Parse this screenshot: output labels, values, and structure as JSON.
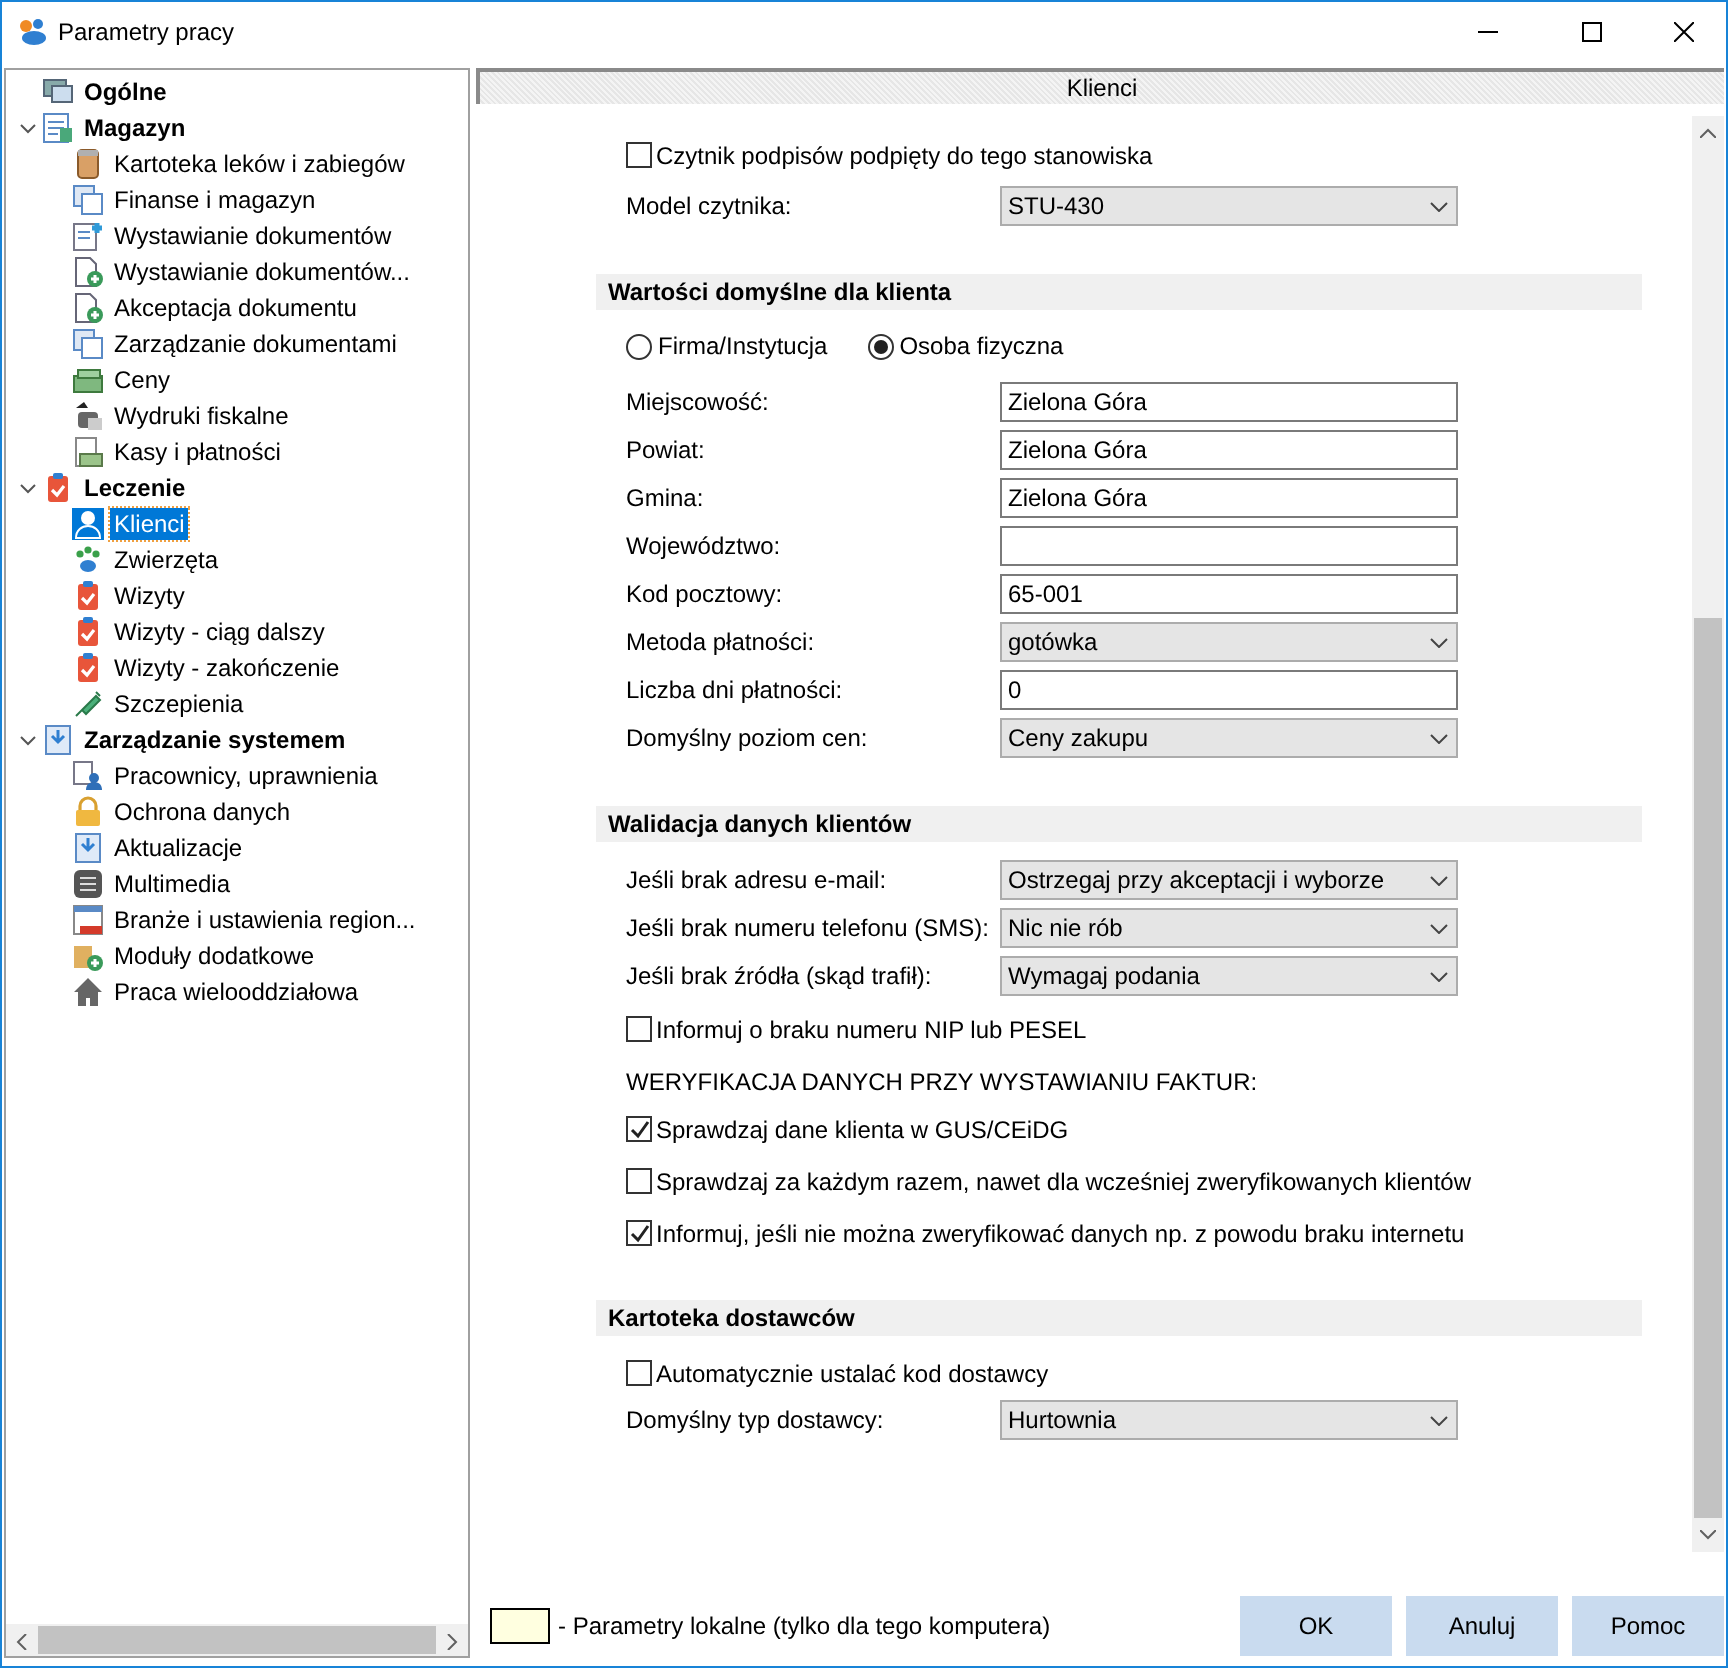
{
  "window": {
    "title": "Parametry pracy"
  },
  "tree": [
    {
      "label": "Ogólne",
      "selected": false
    },
    {
      "label": "Magazyn",
      "selected": false,
      "expanded": true,
      "children": [
        {
          "label": "Kartoteka leków i zabiegów",
          "selected": false
        },
        {
          "label": "Finanse i magazyn",
          "selected": false
        },
        {
          "label": "Wystawianie dokumentów",
          "selected": false
        },
        {
          "label": "Wystawianie dokumentów...",
          "selected": false
        },
        {
          "label": "Akceptacja dokumentu",
          "selected": false
        },
        {
          "label": "Zarządzanie dokumentami",
          "selected": false
        },
        {
          "label": "Ceny",
          "selected": false
        },
        {
          "label": "Wydruki fiskalne",
          "selected": false
        },
        {
          "label": "Kasy i płatności",
          "selected": false
        }
      ]
    },
    {
      "label": "Leczenie",
      "selected": false,
      "expanded": true,
      "children": [
        {
          "label": "Klienci",
          "selected": true
        },
        {
          "label": "Zwierzęta",
          "selected": false
        },
        {
          "label": "Wizyty",
          "selected": false
        },
        {
          "label": "Wizyty - ciąg dalszy",
          "selected": false
        },
        {
          "label": "Wizyty - zakończenie",
          "selected": false
        },
        {
          "label": "Szczepienia",
          "selected": false
        }
      ]
    },
    {
      "label": "Zarządzanie systemem",
      "selected": false,
      "expanded": true,
      "children": [
        {
          "label": "Pracownicy, uprawnienia",
          "selected": false
        },
        {
          "label": "Ochrona danych",
          "selected": false
        },
        {
          "label": "Aktualizacje",
          "selected": false
        },
        {
          "label": "Multimedia",
          "selected": false
        },
        {
          "label": "Branże i ustawienia region...",
          "selected": false
        },
        {
          "label": "Moduły dodatkowe",
          "selected": false
        },
        {
          "label": "Praca wielooddziałowa",
          "selected": false
        }
      ]
    }
  ],
  "panel": {
    "title": "Klienci"
  },
  "content": [
    {
      "kind": "checkbox",
      "label": "Czytnik podpisów podpięty do tego stanowiska",
      "checked": false
    },
    {
      "kind": "select",
      "label": "Model czytnika:",
      "value": "STU-430"
    },
    {
      "kind": "section",
      "label": "Wartości domyślne dla klienta"
    },
    {
      "kind": "radios",
      "options": [
        {
          "label": "Firma/Instytucja",
          "selected": false
        },
        {
          "label": "Osoba fizyczna",
          "selected": true
        }
      ]
    },
    {
      "kind": "input",
      "label": "Miejscowość:",
      "value": "Zielona Góra"
    },
    {
      "kind": "input",
      "label": "Powiat:",
      "value": "Zielona Góra"
    },
    {
      "kind": "input",
      "label": "Gmina:",
      "value": "Zielona Góra"
    },
    {
      "kind": "input",
      "label": "Województwo:"
    },
    {
      "kind": "input",
      "label": "Kod pocztowy:",
      "value": "65-001"
    },
    {
      "kind": "select",
      "label": "Metoda płatności:",
      "value": "gotówka"
    },
    {
      "kind": "input",
      "label": "Liczba dni płatności:",
      "value": "0"
    },
    {
      "kind": "select",
      "label": "Domyślny poziom cen:",
      "value": "Ceny zakupu"
    },
    {
      "kind": "section",
      "label": "Walidacja danych klientów"
    },
    {
      "kind": "select",
      "label": "Jeśli brak adresu e-mail:",
      "value": "Ostrzegaj przy akceptacji i wyborze"
    },
    {
      "kind": "select",
      "label": "Jeśli brak numeru telefonu (SMS):",
      "value": "Nic nie rób"
    },
    {
      "kind": "select",
      "label": "Jeśli brak źródła (skąd trafił):",
      "value": "Wymagaj podania"
    },
    {
      "kind": "checkbox",
      "label": "Informuj o braku numeru NIP lub PESEL",
      "checked": false
    },
    {
      "kind": "note",
      "label": "WERYFIKACJA DANYCH PRZY WYSTAWIANIU FAKTUR:"
    },
    {
      "kind": "checkbox",
      "label": "Sprawdzaj dane klienta w GUS/CEiDG",
      "checked": true
    },
    {
      "kind": "checkbox",
      "label": "Sprawdzaj za każdym razem, nawet dla wcześniej zweryfikowanych klientów",
      "checked": false
    },
    {
      "kind": "checkbox",
      "label": "Informuj, jeśli nie można zweryfikować danych np. z powodu braku internetu",
      "checked": true
    },
    {
      "kind": "section",
      "label": "Kartoteka dostawców"
    },
    {
      "kind": "checkbox",
      "label": "Automatycznie ustalać kod dostawcy",
      "checked": false
    },
    {
      "kind": "select",
      "label": "Domyślny typ dostawcy:",
      "value": "Hurtownia"
    }
  ],
  "legend": {
    "text": "- Parametry lokalne (tylko dla tego komputera)"
  },
  "buttons": [
    "OK",
    "Anuluj",
    "Pomoc"
  ]
}
